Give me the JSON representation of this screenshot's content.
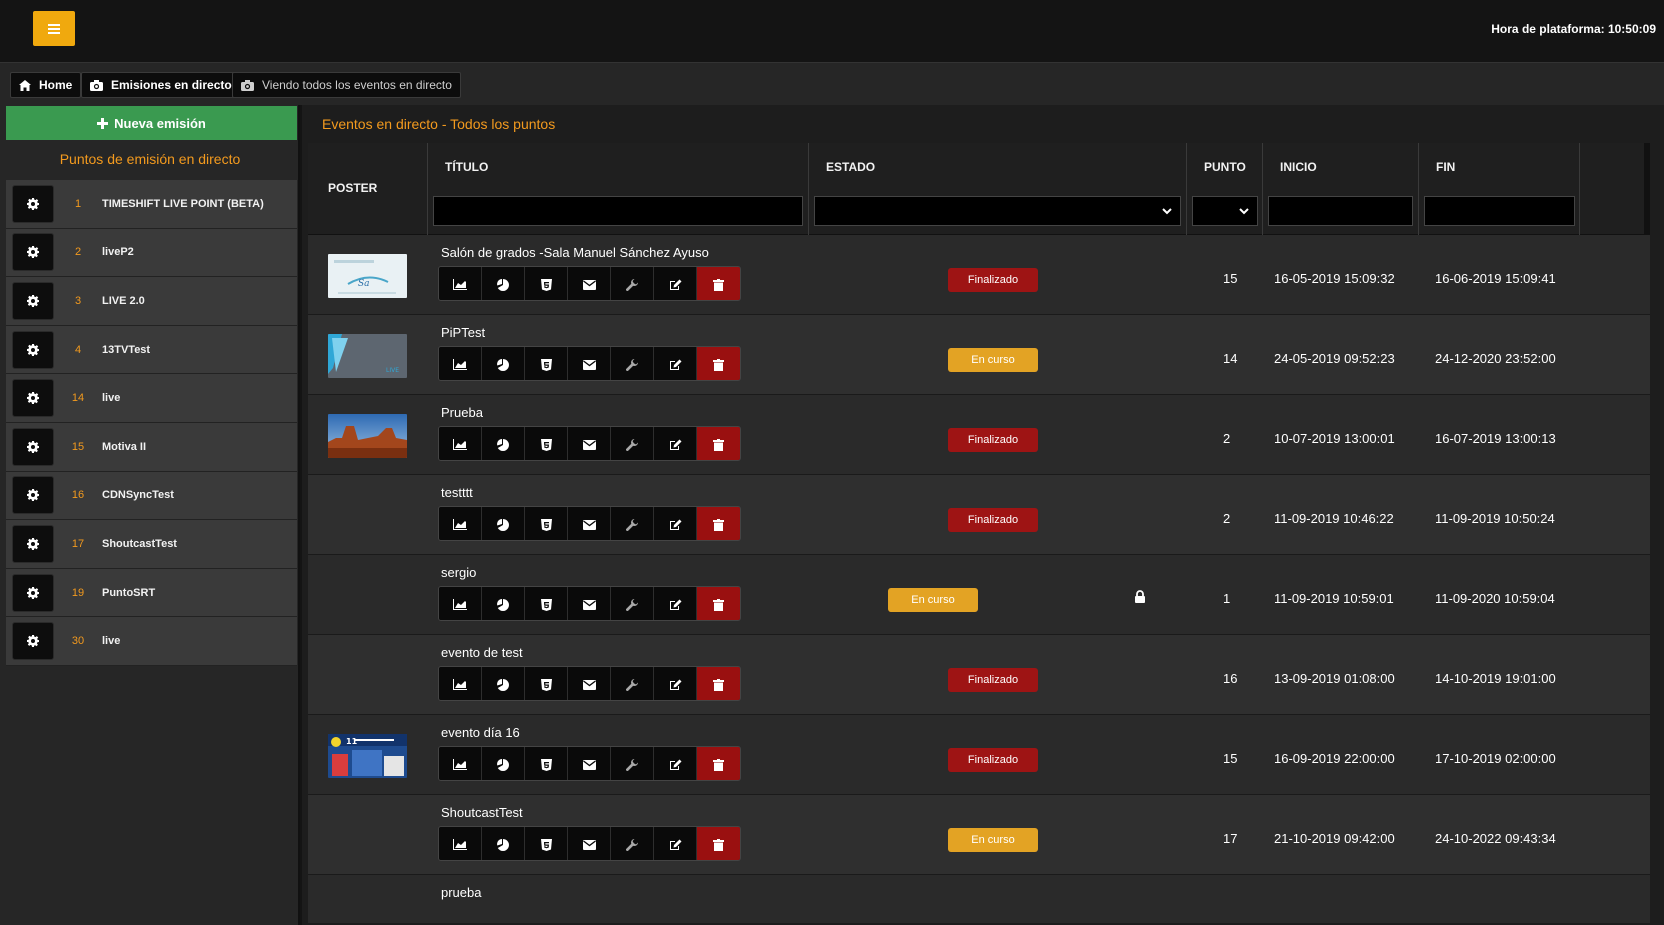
{
  "header": {
    "platform_time": "Hora de plataforma: 10:50:09"
  },
  "breadcrumbs": [
    {
      "label": "Home",
      "icon": "home-icon"
    },
    {
      "label": "Emisiones en directo",
      "icon": "camera-icon"
    },
    {
      "label": "Viendo todos los eventos en directo",
      "icon": "camera-icon"
    }
  ],
  "sidebar": {
    "new_button": "Nueva emisión",
    "title": "Puntos de emisión en directo",
    "points": [
      {
        "num": "1",
        "name": "TIMESHIFT LIVE POINT (BETA)"
      },
      {
        "num": "2",
        "name": "liveP2"
      },
      {
        "num": "3",
        "name": "LIVE 2.0"
      },
      {
        "num": "4",
        "name": "13TVTest"
      },
      {
        "num": "14",
        "name": "live"
      },
      {
        "num": "15",
        "name": "Motiva II"
      },
      {
        "num": "16",
        "name": "CDNSyncTest"
      },
      {
        "num": "17",
        "name": "ShoutcastTest"
      },
      {
        "num": "19",
        "name": "PuntoSRT"
      },
      {
        "num": "30",
        "name": "live"
      }
    ]
  },
  "main": {
    "title": "Eventos en directo - Todos los puntos",
    "columns": {
      "poster": "POSTER",
      "title": "TÍTULO",
      "state": "ESTADO",
      "point": "PUNTO",
      "start": "INICIO",
      "end": "FIN"
    },
    "rows": [
      {
        "title": "Salón de grados -Sala Manuel Sánchez Ayuso",
        "status": "Finalizado",
        "status_type": "fin",
        "point": "15",
        "start": "16-05-2019 15:09:32",
        "end": "16-06-2019 15:09:41",
        "poster": "light"
      },
      {
        "title": "PiPTest",
        "status": "En curso",
        "status_type": "on",
        "point": "14",
        "start": "24-05-2019 09:52:23",
        "end": "24-12-2020 23:52:00",
        "poster": "grey"
      },
      {
        "title": "Prueba",
        "status": "Finalizado",
        "status_type": "fin",
        "point": "2",
        "start": "10-07-2019 13:00:01",
        "end": "16-07-2019 13:00:13",
        "poster": "desert"
      },
      {
        "title": "testttt",
        "status": "Finalizado",
        "status_type": "fin",
        "point": "2",
        "start": "11-09-2019 10:46:22",
        "end": "11-09-2019 10:50:24",
        "poster": ""
      },
      {
        "title": "sergio",
        "status": "En curso",
        "status_type": "on",
        "point": "1",
        "start": "11-09-2019 10:59:01",
        "end": "11-09-2020 10:59:04",
        "poster": "",
        "locked": true
      },
      {
        "title": "evento de test",
        "status": "Finalizado",
        "status_type": "fin",
        "point": "16",
        "start": "13-09-2019 01:08:00",
        "end": "14-10-2019 19:01:00",
        "poster": ""
      },
      {
        "title": "evento día 16",
        "status": "Finalizado",
        "status_type": "fin",
        "point": "15",
        "start": "16-09-2019 22:00:00",
        "end": "17-10-2019 02:00:00",
        "poster": "blue"
      },
      {
        "title": "ShoutcastTest",
        "status": "En curso",
        "status_type": "on",
        "point": "17",
        "start": "21-10-2019 09:42:00",
        "end": "24-10-2022 09:43:34",
        "poster": ""
      },
      {
        "title": "prueba",
        "status": "",
        "status_type": "",
        "point": "",
        "start": "",
        "end": "",
        "poster": "",
        "partial": true
      }
    ]
  },
  "colors": {
    "accent_orange": "#f39a1e",
    "menu_yellow": "#f0a90e",
    "green": "#3a9a50",
    "danger": "#9e1414",
    "warning": "#e3a324"
  }
}
